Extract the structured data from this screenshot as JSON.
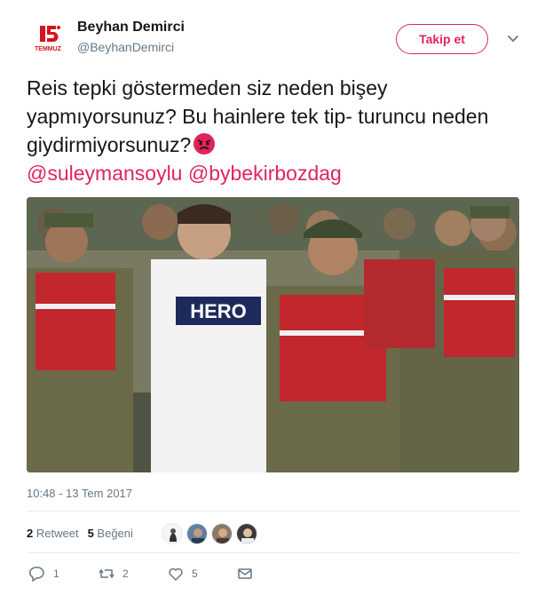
{
  "user": {
    "display_name": "Beyhan Demirci",
    "handle": "@BeyhanDemirci",
    "avatar_icon": "15-temmuz-logo",
    "avatar_text": "TEMMUZ",
    "avatar_number": "15"
  },
  "header": {
    "follow_label": "Takip et",
    "menu_icon": "chevron-down-icon"
  },
  "tweet": {
    "text_line": "Reis tepki göstermeden siz neden bişey yapmıyorsunuz? Bu hainlere tek tip- turuncu neden giydirmiyorsunuz?",
    "emoji": "angry-face-emoji",
    "mentions": [
      "@suleymansoylu",
      "@bybekirbozdag"
    ],
    "media_shirt_text": "HERO"
  },
  "meta": {
    "timestamp": "10:48 - 13 Tem 2017"
  },
  "stats": {
    "retweet_count": "2",
    "retweet_label": "Retweet",
    "like_count": "5",
    "like_label": "Beğeni"
  },
  "actions": {
    "reply_count": "1",
    "retweet_count": "2",
    "like_count": "5"
  },
  "colors": {
    "accent": "#e0245e",
    "text": "#14171a",
    "muted": "#657786"
  }
}
